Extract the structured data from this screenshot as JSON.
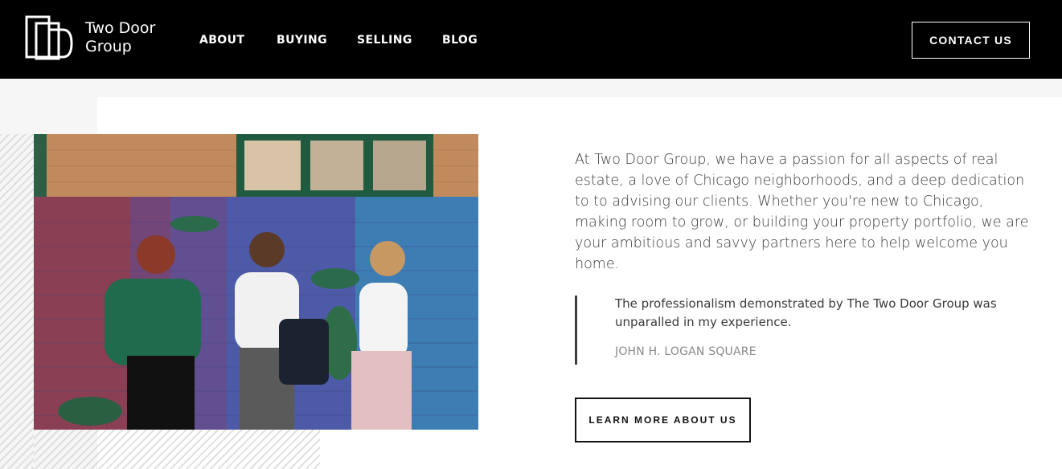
{
  "brand": {
    "name_line1": "Two Door",
    "name_line2": "Group"
  },
  "nav": {
    "items": [
      "ABOUT",
      "BUYING",
      "SELLING",
      "BLOG"
    ]
  },
  "header": {
    "contact_label": "CONTACT US"
  },
  "intro": {
    "paragraph": "At Two Door Group, we have a passion for all aspects of real estate, a love of Chicago neighborhoods, and a deep dedication to to advising our clients. Whether you're new to Chicago, making room to grow, or building your property portfolio, we are your ambitious and savvy partners here to help welcome you home."
  },
  "testimonial": {
    "quote": "The professionalism demonstrated by The Two Door Group was unparalled in my experience.",
    "author": "JOHN H. LOGAN SQUARE"
  },
  "cta": {
    "learn_more_label": "LEARN MORE ABOUT US"
  },
  "colors": {
    "header_bg": "#000000",
    "page_bg": "#f6f6f6",
    "card_bg": "#ffffff",
    "text": "#3a3a3a",
    "muted": "#8a8a8a"
  }
}
